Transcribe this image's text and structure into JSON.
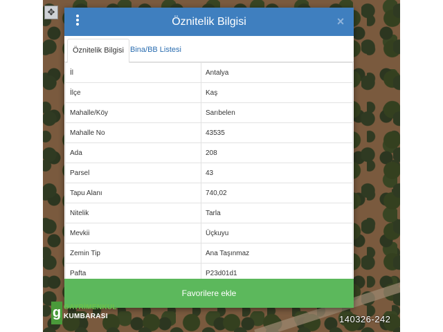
{
  "dialog": {
    "title": "Öznitelik Bilgisi",
    "close_glyph": "×",
    "menu_icon": "vertical-ellipsis-icon",
    "header_color": "#3f7fbf"
  },
  "tabs": [
    {
      "label": "Öznitelik Bilgisi",
      "active": true
    },
    {
      "label": "Bina/BB Listesi",
      "active": false
    }
  ],
  "attributes": [
    {
      "key": "İl",
      "value": "Antalya"
    },
    {
      "key": "İlçe",
      "value": "Kaş"
    },
    {
      "key": "Mahalle/Köy",
      "value": "Sarıbelen"
    },
    {
      "key": "Mahalle No",
      "value": "43535"
    },
    {
      "key": "Ada",
      "value": "208"
    },
    {
      "key": "Parsel",
      "value": "43"
    },
    {
      "key": "Tapu Alanı",
      "value": "740,02"
    },
    {
      "key": "Nitelik",
      "value": "Tarla"
    },
    {
      "key": "Mevkii",
      "value": "Üçkuyu"
    },
    {
      "key": "Zemin Tip",
      "value": "Ana Taşınmaz"
    },
    {
      "key": "Pafta",
      "value": "P23d01d1"
    }
  ],
  "favorite_button": {
    "label": "Favorilere ekle",
    "color": "#5cb85c"
  },
  "watermark": {
    "line1": "GAYRİMENKUL",
    "line2": "KUMBARASI",
    "mark": "g"
  },
  "listing_id": "140326-242",
  "map_tool_icon": "move-icon"
}
